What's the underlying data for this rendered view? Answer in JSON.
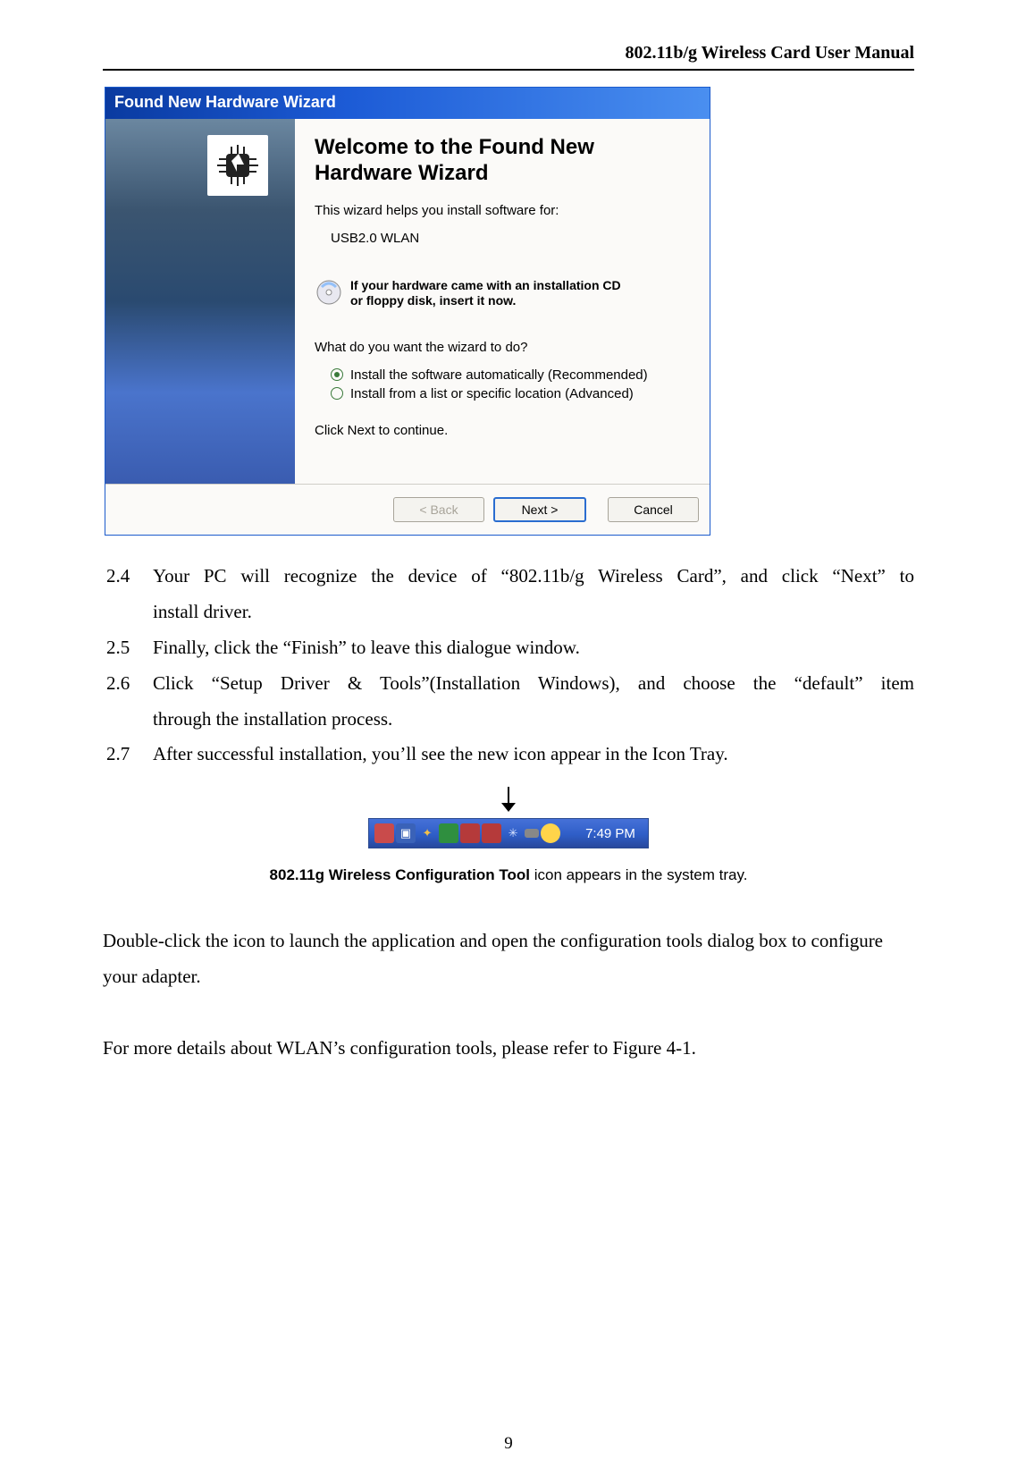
{
  "header": {
    "title": "802.11b/g Wireless Card User Manual"
  },
  "wizard": {
    "title": "Found New Hardware Wizard",
    "heading_line1": "Welcome to the Found New",
    "heading_line2": "Hardware Wizard",
    "subtitle": "This wizard helps you install software for:",
    "device": "USB2.0 WLAN",
    "cd_hint_line1": "If your hardware came with an installation CD",
    "cd_hint_line2": "or floppy disk, insert it now.",
    "question": "What do you want the wizard to do?",
    "radio1": "Install the software automatically (Recommended)",
    "radio2": "Install from a list or specific location (Advanced)",
    "continue": "Click Next to continue.",
    "back": "< Back",
    "next": "Next >",
    "cancel": "Cancel"
  },
  "list": {
    "n24": "2.4",
    "t24a": "Your PC will recognize the device of “802.11b/g Wireless Card”, and click “Next” to",
    "t24b": "install driver.",
    "n25": "2.5",
    "t25": "Finally, click the “Finish” to leave this dialogue window.",
    "n26": "2.6",
    "t26a": "Click “Setup Driver & Tools”(Installation Windows), and choose the “default” item",
    "t26b": "through the installation process.",
    "n27": "2.7",
    "t27": "After successful installation, you’ll see the new icon appear in the Icon Tray."
  },
  "tray": {
    "time": "7:49 PM"
  },
  "caption": {
    "bold": "802.11g Wireless Configuration Tool",
    "rest": " icon appears in the system tray."
  },
  "paras": {
    "p1": "Double-click the icon to launch the application and open the configuration tools dialog box to configure your adapter.",
    "p2": "For more details about WLAN’s configuration tools, please refer to Figure 4-1."
  },
  "page_number": "9"
}
